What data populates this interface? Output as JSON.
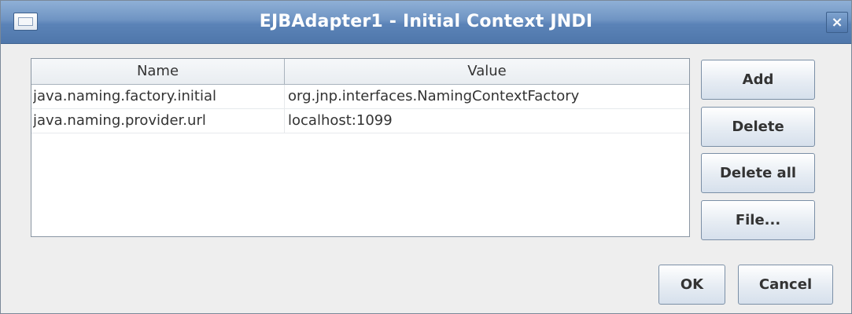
{
  "window": {
    "title": "EJBAdapter1 - Initial Context JNDI"
  },
  "icons": {
    "window_menu": "window-menu-icon",
    "close": "close-icon"
  },
  "table": {
    "columns": [
      "Name",
      "Value"
    ],
    "rows": [
      {
        "name": "java.naming.factory.initial",
        "value": "org.jnp.interfaces.NamingContextFactory"
      },
      {
        "name": "java.naming.provider.url",
        "value": "localhost:1099"
      }
    ]
  },
  "buttons": {
    "add": "Add",
    "delete": "Delete",
    "delete_all": "Delete all",
    "file": "File...",
    "ok": "OK",
    "cancel": "Cancel"
  },
  "colors": {
    "titlebar": "#5b83b7",
    "background": "#eeeeee",
    "table_background": "#ffffff"
  }
}
